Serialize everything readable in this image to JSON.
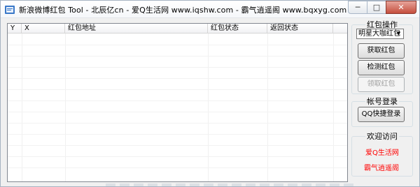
{
  "window": {
    "title": "新浪微博红包 Tool - 北辰亿cn  -  爱Q生活网 www.iqshw.com  -  霸气逍遥阁 www.bqxyg.com",
    "controls": {
      "minimize": "─",
      "maximize": "□",
      "close": "✕"
    }
  },
  "list": {
    "columns": [
      "Y",
      "X",
      "红包地址",
      "红包状态",
      "返回状态"
    ]
  },
  "redpacket_ops": {
    "title": "红包操作",
    "select_value": "明星大咖红包",
    "get_button": "获取红包",
    "check_button": "检测红包",
    "claim_button": "领取红包"
  },
  "account": {
    "title": "帐号登录",
    "qq_login_button": "QQ快捷登录"
  },
  "welcome": {
    "title": "欢迎访问",
    "link1": "爱Q生活网",
    "link2": "霸气逍遥阁"
  },
  "colors": {
    "link": "#ff0000",
    "close_button": "#c44e3d"
  }
}
